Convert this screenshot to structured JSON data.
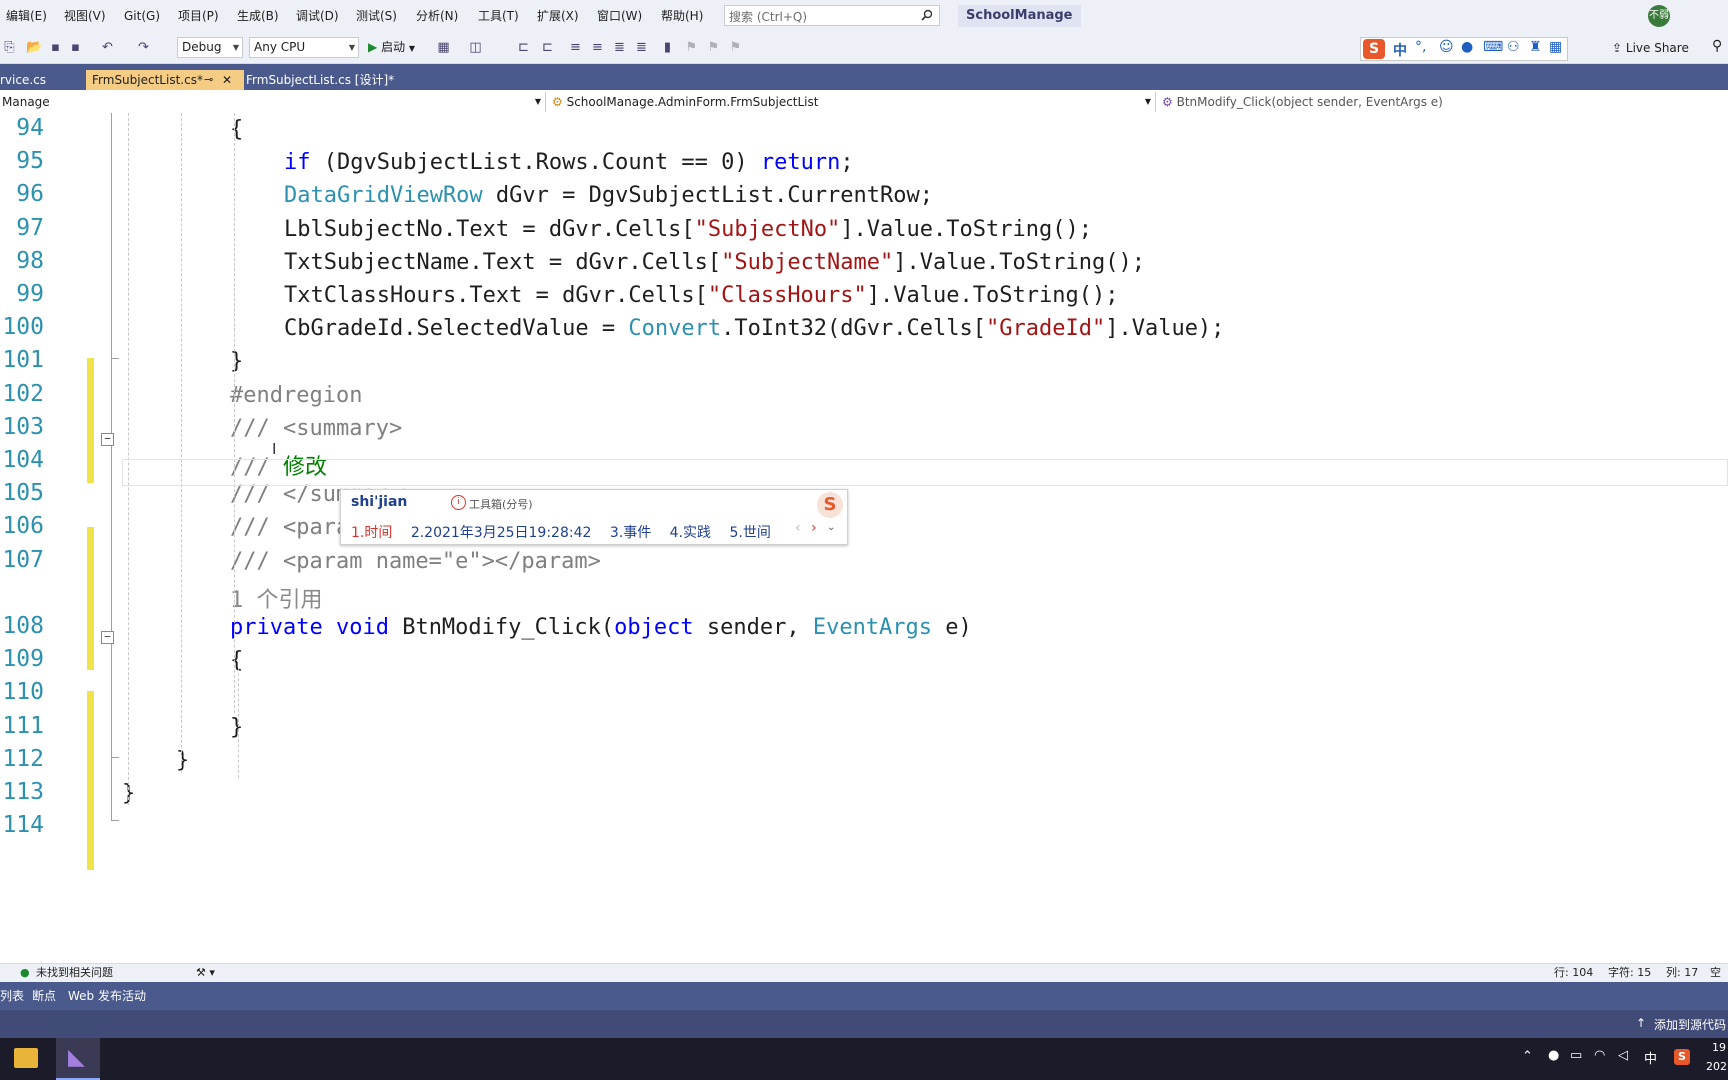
{
  "menu": {
    "items": [
      "编辑(E)",
      "视图(V)",
      "Git(G)",
      "项目(P)",
      "生成(B)",
      "调试(D)",
      "测试(S)",
      "分析(N)",
      "工具(T)",
      "扩展(X)",
      "窗口(W)",
      "帮助(H)"
    ],
    "search_placeholder": "搜索 (Ctrl+Q)",
    "solution_name": "SchoolManage",
    "avatar_text": "不弱"
  },
  "toolbar": {
    "config": "Debug",
    "platform": "Any CPU",
    "start_label": "启动",
    "live_share": "Live Share"
  },
  "ime_bar": {
    "mode": "中"
  },
  "tabs": [
    "rvice.cs",
    "FrmSubjectList.cs*",
    "FrmSubjectList.cs [设计]*"
  ],
  "nav": {
    "project": "Manage",
    "class": "SchoolManage.AdminForm.FrmSubjectList",
    "member": "BtnModify_Click(object sender, EventArgs e)"
  },
  "code_lines": [
    {
      "n": "94",
      "seg": [
        [
          "p",
          "{"
        ]
      ]
    },
    {
      "n": "95",
      "seg": [
        [
          "kw",
          "if"
        ],
        [
          "p",
          " (DgvSubjectList.Rows.Count == 0) "
        ],
        [
          "kw",
          "return"
        ],
        [
          "p",
          ";"
        ]
      ]
    },
    {
      "n": "96",
      "seg": [
        [
          "ty",
          "DataGridViewRow"
        ],
        [
          "p",
          " dGvr = DgvSubjectList.CurrentRow;"
        ]
      ]
    },
    {
      "n": "97",
      "seg": [
        [
          "p",
          "LblSubjectNo.Text = dGvr.Cells["
        ],
        [
          "st",
          "\"SubjectNo\""
        ],
        [
          "p",
          "].Value.ToString();"
        ]
      ]
    },
    {
      "n": "98",
      "seg": [
        [
          "p",
          "TxtSubjectName.Text = dGvr.Cells["
        ],
        [
          "st",
          "\"SubjectName\""
        ],
        [
          "p",
          "].Value.ToString();"
        ]
      ]
    },
    {
      "n": "99",
      "seg": [
        [
          "p",
          "TxtClassHours.Text = dGvr.Cells["
        ],
        [
          "st",
          "\"ClassHours\""
        ],
        [
          "p",
          "].Value.ToString();"
        ]
      ]
    },
    {
      "n": "100",
      "seg": [
        [
          "p",
          "CbGradeId.SelectedValue = "
        ],
        [
          "ty",
          "Convert"
        ],
        [
          "p",
          ".ToInt32(dGvr.Cells["
        ],
        [
          "st",
          "\"GradeId\""
        ],
        [
          "p",
          "].Value);"
        ]
      ]
    },
    {
      "n": "101",
      "seg": [
        [
          "p",
          "}"
        ]
      ]
    },
    {
      "n": "102",
      "seg": [
        [
          "pp",
          "#endregion"
        ]
      ]
    },
    {
      "n": "103",
      "seg": [
        [
          "cm",
          "/// <summary>"
        ]
      ]
    },
    {
      "n": "104",
      "seg": [
        [
          "cm",
          "/// "
        ],
        [
          "cg",
          "修改"
        ]
      ]
    },
    {
      "n": "105",
      "seg": [
        [
          "cm",
          "/// </summary>"
        ]
      ]
    },
    {
      "n": "106",
      "seg": [
        [
          "cm",
          "/// <param name=\"sender\"></param>"
        ]
      ]
    },
    {
      "n": "107",
      "seg": [
        [
          "cm",
          "/// <param name=\"e\"></param>"
        ]
      ]
    },
    {
      "n": "",
      "seg": [
        [
          "ref",
          "1 个引用"
        ]
      ]
    },
    {
      "n": "108",
      "seg": [
        [
          "kw",
          "private"
        ],
        [
          "p",
          " "
        ],
        [
          "kw",
          "void"
        ],
        [
          "p",
          " BtnModify_Click("
        ],
        [
          "kw",
          "object"
        ],
        [
          "p",
          " sender, "
        ],
        [
          "ty",
          "EventArgs"
        ],
        [
          "p",
          " e)"
        ]
      ]
    },
    {
      "n": "109",
      "seg": [
        [
          "p",
          "{"
        ]
      ]
    },
    {
      "n": "110",
      "seg": [
        [
          "p",
          ""
        ]
      ]
    },
    {
      "n": "111",
      "seg": [
        [
          "p",
          "}"
        ]
      ]
    },
    {
      "n": "112",
      "seg": [
        [
          "p",
          "}"
        ]
      ]
    },
    {
      "n": "113",
      "seg": [
        [
          "p",
          "}"
        ]
      ]
    },
    {
      "n": "114",
      "seg": [
        [
          "p",
          ""
        ]
      ]
    }
  ],
  "ime_popup": {
    "input": "shi'jian",
    "hint": "工具箱(分号)",
    "candidates": [
      "1.时间",
      "2.2021年3月25日19:28:42",
      "3.事件",
      "4.实践",
      "5.世间"
    ]
  },
  "status": {
    "issues": "未找到相关问题",
    "line": "行: 104",
    "char": "字符: 15",
    "col": "列: 17",
    "spc": "空格"
  },
  "bottom_tabs": [
    "列表",
    "断点",
    "Web 发布活动"
  ],
  "source_control": "添加到源代码",
  "taskbar": {
    "clock_time": "19",
    "clock_date": "202",
    "ime": "中"
  }
}
